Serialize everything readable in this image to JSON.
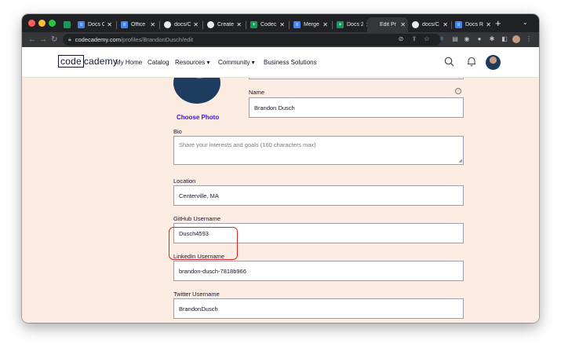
{
  "browser": {
    "tabs": [
      {
        "label": "Docs C",
        "favicon_color": "#4285f4",
        "favicon_glyph": "≡"
      },
      {
        "label": "Office",
        "favicon_color": "#4285f4",
        "favicon_glyph": "≡"
      },
      {
        "label": "docs/C",
        "favicon_color": "#e8eaed",
        "favicon_glyph": "●"
      },
      {
        "label": "Create",
        "favicon_color": "#e8eaed",
        "favicon_glyph": "●"
      },
      {
        "label": "Codec",
        "favicon_color": "#0f9d58",
        "favicon_glyph": "+"
      },
      {
        "label": "Merge",
        "favicon_color": "#4285f4",
        "favicon_glyph": "≡"
      },
      {
        "label": "Docs 2",
        "favicon_color": "#0f9d58",
        "favicon_glyph": "+"
      },
      {
        "label": "Edit Pr",
        "favicon_color": "#35363a",
        "favicon_glyph": ""
      },
      {
        "label": "docs/C",
        "favicon_color": "#e8eaed",
        "favicon_glyph": "●"
      },
      {
        "label": "Docs R",
        "favicon_color": "#4285f4",
        "favicon_glyph": "≡"
      }
    ],
    "active_tab": 7,
    "url_host": "codecademy.com",
    "url_path": "/profiles/BrandonDusch/edit"
  },
  "header": {
    "logo_left": "code",
    "logo_right": "cademy",
    "nav": [
      "My Home",
      "Catalog",
      "Resources ▾",
      "Community ▾",
      "Business Solutions"
    ]
  },
  "profile": {
    "choose_photo": "Choose Photo",
    "name_label": "Name",
    "name_value": "Brandon Dusch",
    "bio_label": "Bio",
    "bio_placeholder": "Share your interests and goals (160 characters max)",
    "location_label": "Location",
    "location_value": "Centerville, MA",
    "github_label": "GitHub Username",
    "github_value": "Dusch4593",
    "linkedin_label": "LinkedIn Username",
    "linkedin_value": "brandon-dusch-7818b966",
    "twitter_label": "Twitter Username",
    "twitter_value": "BrandonDusch"
  },
  "colors": {
    "page_bg": "#fdece1",
    "accent_link": "#3a10e5",
    "highlight": "#d8272a"
  }
}
